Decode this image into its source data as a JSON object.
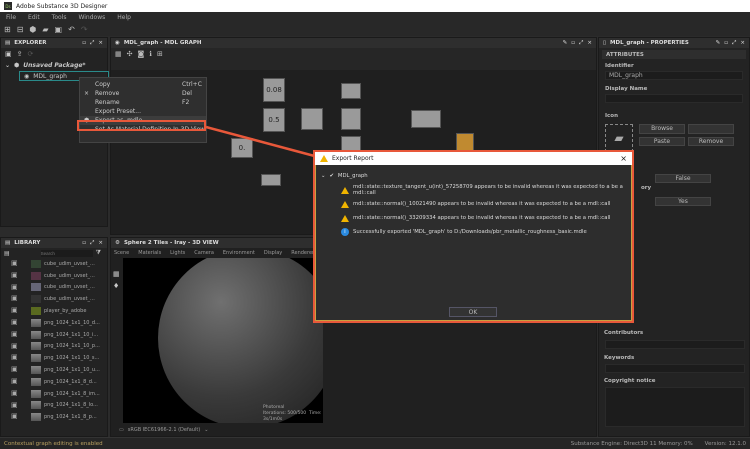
{
  "app": {
    "title": "Adobe Substance 3D Designer",
    "logo": "Ds"
  },
  "menu": [
    "File",
    "Edit",
    "Tools",
    "Windows",
    "Help"
  ],
  "explorer": {
    "title": "EXPLORER",
    "package": "Unsaved Package*",
    "graph": "MDL_graph"
  },
  "context_menu": [
    {
      "label": "Copy",
      "shortcut": "Ctrl+C"
    },
    {
      "label": "Remove",
      "shortcut": "Del",
      "icon": "×"
    },
    {
      "label": "Rename",
      "shortcut": "F2"
    },
    {
      "label": "Export Preset..."
    },
    {
      "label": "Export as .mdle...",
      "icon": "⬢"
    },
    {
      "label": "Set As Material Definition In 3D View"
    }
  ],
  "graph": {
    "title": "MDL_graph - MDL GRAPH",
    "nodes": [
      "0.08",
      "0.5",
      "0."
    ]
  },
  "library": {
    "title": "LIBRARY",
    "search_placeholder": "Search",
    "items": [
      "cube_udim_uvset_...",
      "cube_udim_uvset_...",
      "cube_udim_uvset_...",
      "cube_udim_uvset_...",
      "player_by_adobe",
      "png_1024_1x1_10_d...",
      "png_1024_1x1_10_i...",
      "png_1024_1x1_10_p...",
      "png_1024_1x1_10_s...",
      "png_1024_1x1_10_u...",
      "png_1024_1x1_8_d...",
      "png_1024_1x1_8_im...",
      "png_1024_1x1_8_lo...",
      "png_1024_1x1_8_p..."
    ]
  },
  "view3d": {
    "title": "Sphere 2 Tiles - Iray - 3D VIEW",
    "tabs": [
      "Scene",
      "Materials",
      "Lights",
      "Camera",
      "Environment",
      "Display",
      "Renderer"
    ],
    "mode": "Photoreal",
    "iterations": "Iterations: 500/500",
    "time": "Time: 3s/1m0s",
    "colorspace": "sRGB IEC61966-2.1 (Default)"
  },
  "properties": {
    "title": "MDL_graph - PROPERTIES",
    "section": "ATTRIBUTES",
    "identifier_label": "Identifier",
    "identifier": "MDL_graph",
    "display_name_label": "Display Name",
    "icon_label": "Icon",
    "buttons": [
      "Browse",
      "Paste",
      "Remove"
    ],
    "false": "False",
    "yes": "Yes",
    "partial_label": "ory",
    "contributors": "Contributors",
    "keywords": "Keywords",
    "copyright": "Copyright notice"
  },
  "dialog": {
    "title": "Export Report",
    "root": "MDL_graph",
    "messages": [
      {
        "type": "warning",
        "text": "mdl::state::texture_tangent_u(int)_57258709 appears to be invalid whereas it was expected to a be a mdl::call"
      },
      {
        "type": "warning",
        "text": "mdl::state::normal()_10021490 appears to be invalid whereas it was expected to a be a mdl::call"
      },
      {
        "type": "warning",
        "text": "mdl::state::normal()_33209334 appears to be invalid whereas it was expected to a be a mdl::call"
      },
      {
        "type": "info",
        "text": "Successfully exported 'MDL_graph' to D:/Downloads/pbr_metallic_roughness_basic.mdle"
      }
    ],
    "ok": "OK"
  },
  "status": {
    "left": "Contextual graph editing is enabled",
    "engine": "Substance Engine: Direct3D 11  Memory: 0%",
    "version": "Version: 12.1.0"
  },
  "colors": {
    "highlight": "#e8583a",
    "warning": "#f0b400",
    "info": "#2a8ae0"
  }
}
